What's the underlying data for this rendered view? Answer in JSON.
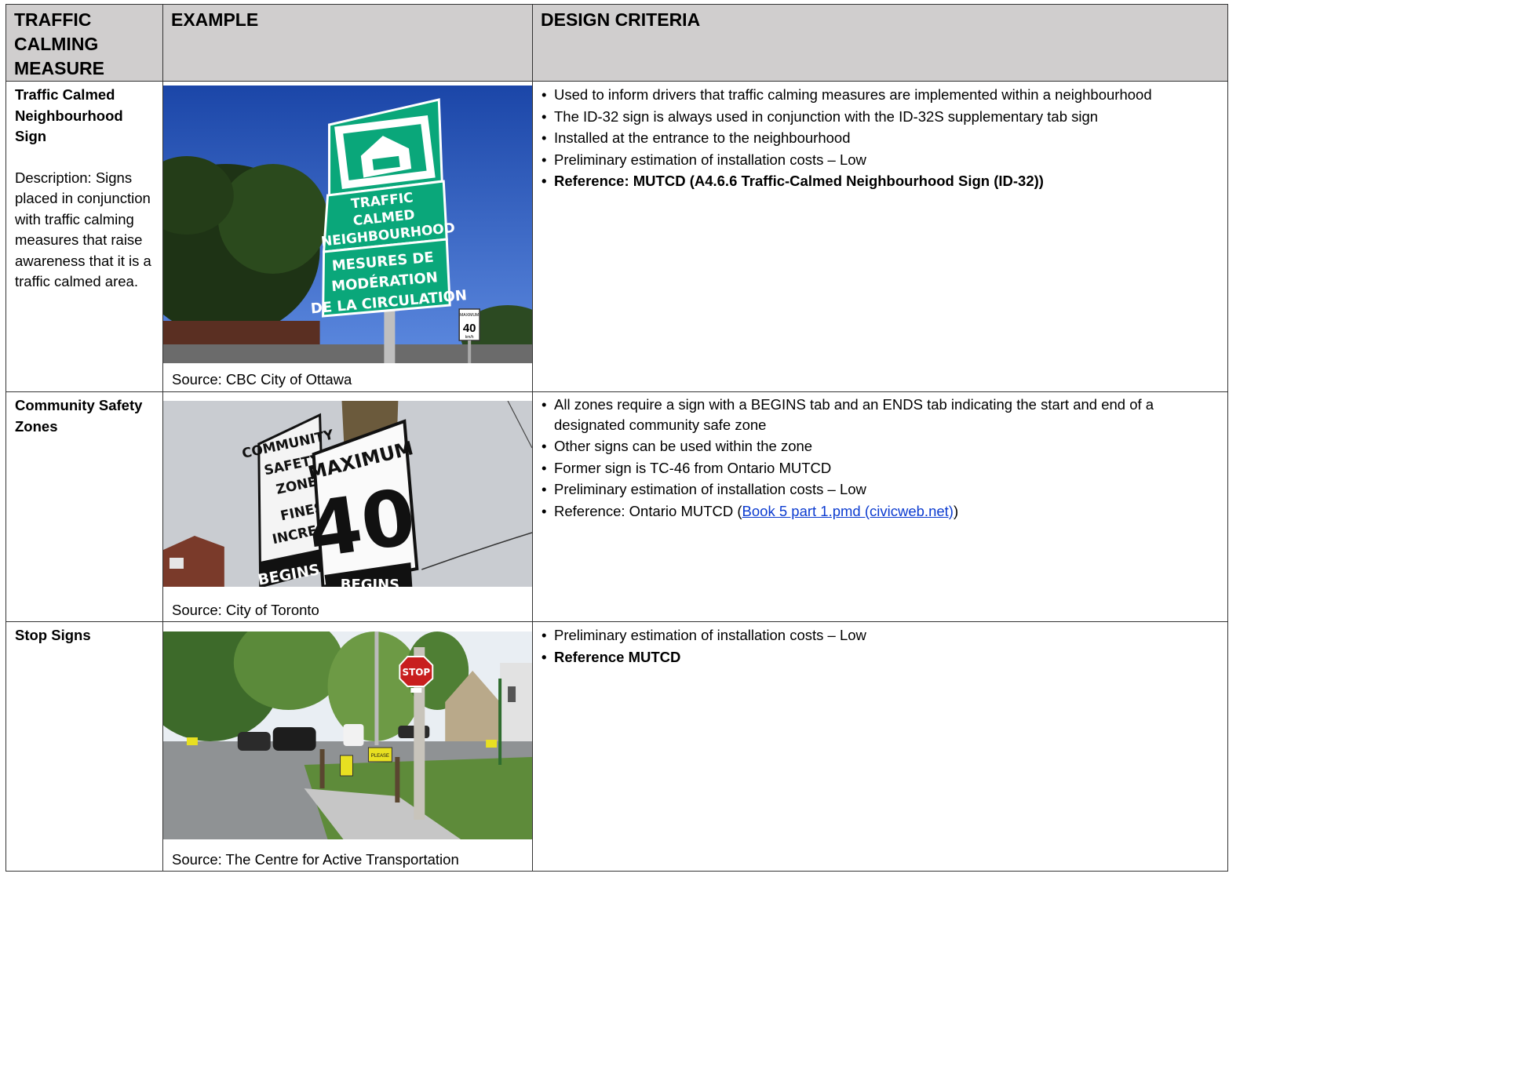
{
  "headers": {
    "measure": "TRAFFIC CALMING MEASURE",
    "example": "EXAMPLE",
    "criteria": "DESIGN CRITERIA"
  },
  "rows": [
    {
      "name": "Traffic Calmed Neighbourhood Sign",
      "description": "Description: Signs placed in conjunction with traffic calming measures that raise awareness that it is a traffic calmed area.",
      "source": "Source: CBC City of Ottawa",
      "photo": {
        "sign_lines_en": [
          "TRAFFIC",
          "CALMED",
          "NEIGHBOURHOOD"
        ],
        "sign_lines_fr": [
          "MESURES DE",
          "MODÉRATION",
          "DE LA CIRCULATION"
        ],
        "max_label": "MAXIMUM",
        "max_value": "40",
        "max_unit": "km/h"
      },
      "criteria": [
        "Used to inform drivers that traffic calming measures are implemented within a neighbourhood",
        "The ID-32 sign is always used in conjunction with the ID-32S supplementary tab sign",
        "Installed at the entrance to the neighbourhood",
        "Preliminary estimation of installation costs – Low",
        "Reference: MUTCD (A4.6.6 Traffic-Calmed Neighbourhood Sign (ID-32))"
      ]
    },
    {
      "name": "Community Safety Zones",
      "source": "Source: City of Toronto",
      "photo": {
        "sign_lines": [
          "COMMUNITY",
          "SAFETY",
          "ZONE",
          "FINES",
          "INCREASE"
        ],
        "tab": "BEGINS",
        "max_label": "MAXIMUM",
        "max_value": "40",
        "tab2": "BEGINS"
      },
      "criteria": [
        "All zones require a sign with a BEGINS tab and an ENDS tab indicating the start and end of a designated community safe zone",
        "Other signs can be used within the zone",
        "Former sign is TC-46 from Ontario MUTCD",
        "Preliminary estimation of installation costs – Low"
      ],
      "reference_prefix": "Reference: Ontario MUTCD (",
      "reference_link": "Book 5 part 1.pmd (civicweb.net)",
      "reference_suffix": ")"
    },
    {
      "name": "Stop Signs",
      "source": "Source: The Centre for Active Transportation",
      "photo": {
        "stop_label": "STOP",
        "placard": "PLEASE"
      },
      "criteria": [
        "Preliminary estimation of installation costs – Low",
        "Reference MUTCD"
      ]
    }
  ],
  "colors": {
    "header_bg": "#d0cece",
    "link": "#0b3bd0",
    "sign_green": "#0aa77a"
  }
}
